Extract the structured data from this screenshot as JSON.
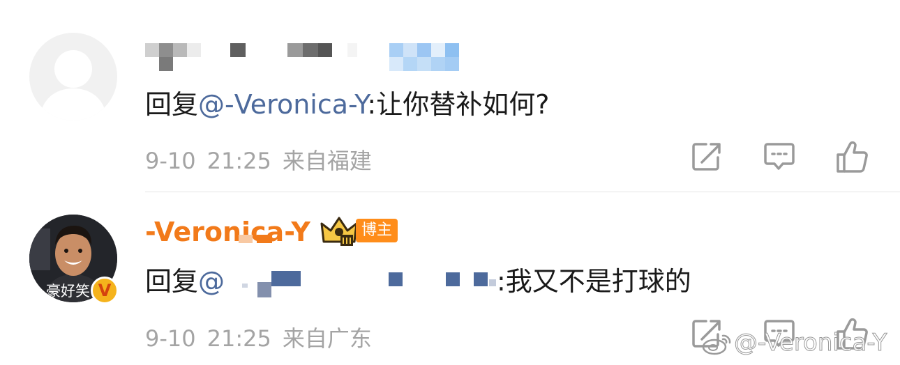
{
  "comments": [
    {
      "reply_prefix": "回复",
      "mention": "@-Veronica-Y",
      "reply_body": ":让你替补如何?",
      "date": "9-10",
      "time": "21:25",
      "location": "来自福建"
    },
    {
      "author": "-Veronica-Y",
      "badge": "博主",
      "avatar_caption": "豪好笑",
      "reply_prefix": "回复",
      "mention_prefix": "@",
      "reply_body": ":我又不是打球的",
      "date": "9-10",
      "time": "21:25",
      "location": "来自广东"
    }
  ],
  "watermark": "@-Veronica-Y",
  "icons": [
    "user-silhouette-icon",
    "share-icon",
    "comment-icon",
    "like-icon",
    "crown-icon",
    "verified-v-icon",
    "weibo-logo-icon"
  ],
  "colors": {
    "author_name": "#f27a1a",
    "mention": "#4d6a9c",
    "meta": "#a4a4a4",
    "badge": "#ff8d1a"
  }
}
